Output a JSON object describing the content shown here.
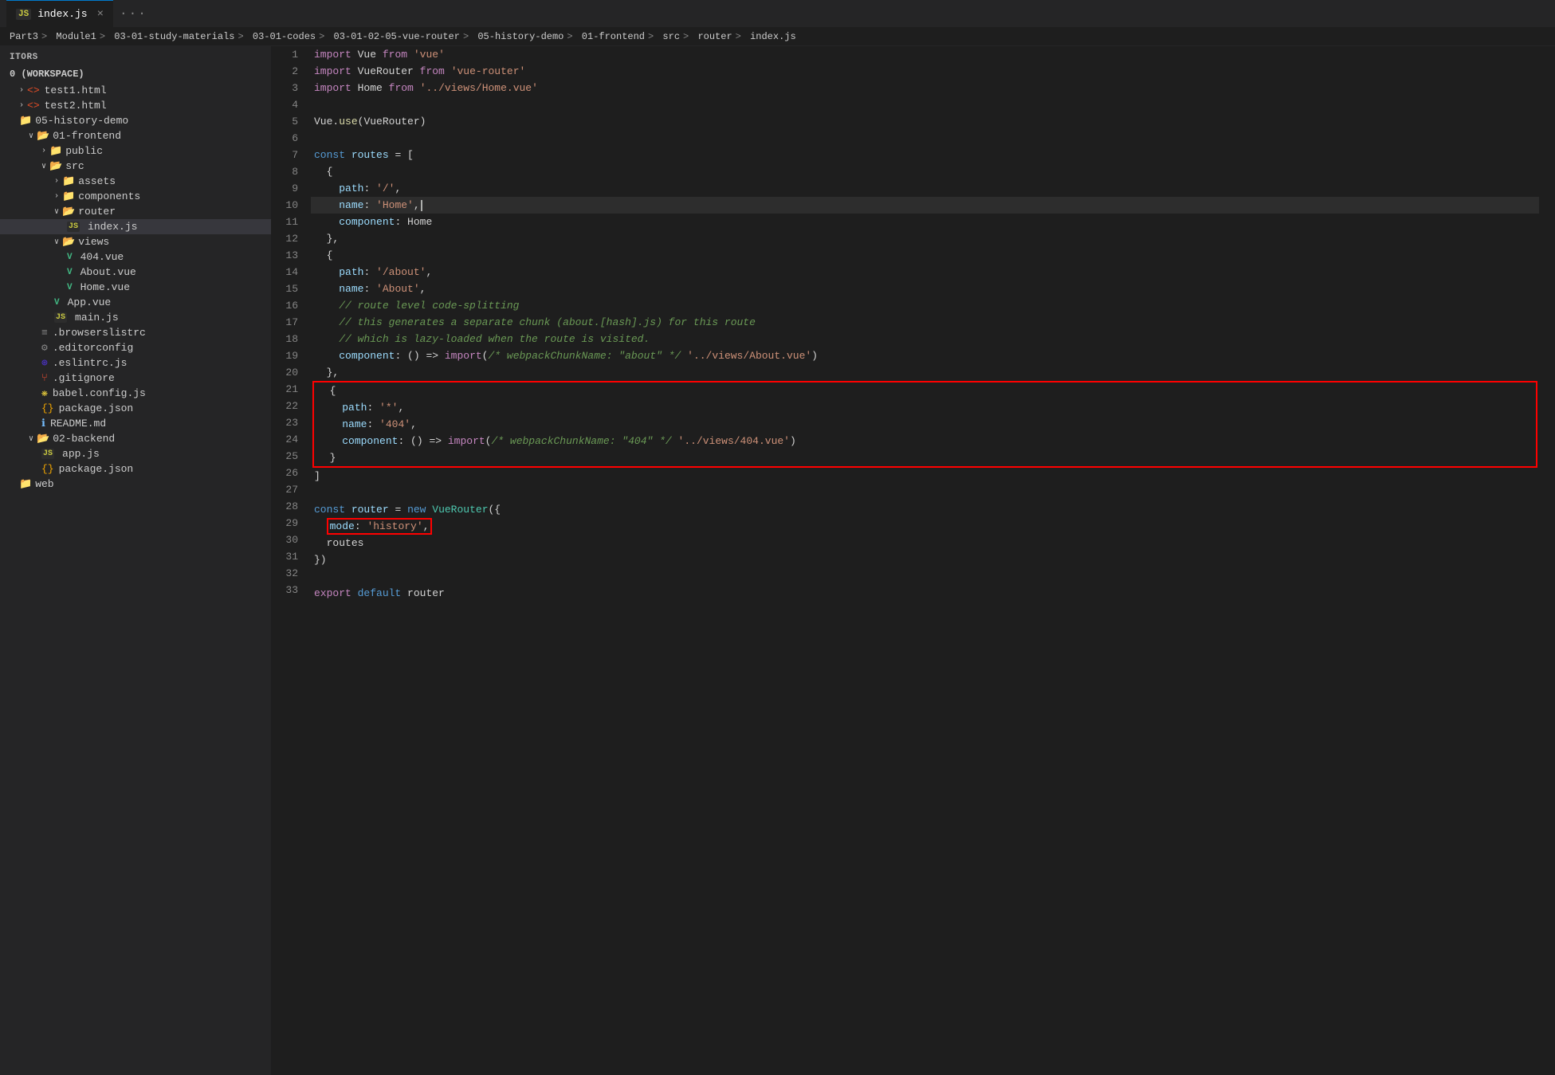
{
  "tab": {
    "icon": "JS",
    "label": "index.js",
    "close": "×"
  },
  "breadcrumb": {
    "parts": [
      "Part3",
      "Module1",
      "03-01-study-materials",
      "03-01-codes",
      "03-01-02-05-vue-router",
      "05-history-demo",
      "01-frontend",
      "src",
      "router",
      "index.js"
    ]
  },
  "sidebar": {
    "header": "ITORS",
    "workspace": "0 (WORKSPACE)",
    "items": [
      {
        "id": "test1",
        "label": "test1.html",
        "icon": "html",
        "indent": 1,
        "expanded": false
      },
      {
        "id": "test2",
        "label": "test2.html",
        "icon": "html",
        "indent": 1,
        "expanded": false
      },
      {
        "id": "05-history-demo",
        "label": "05-history-demo",
        "icon": "folder",
        "indent": 1,
        "expanded": true
      },
      {
        "id": "01-frontend",
        "label": "01-frontend",
        "icon": "folder",
        "indent": 2,
        "expanded": true
      },
      {
        "id": "public",
        "label": "public",
        "icon": "folder",
        "indent": 3,
        "expanded": false
      },
      {
        "id": "src",
        "label": "src",
        "icon": "folder",
        "indent": 3,
        "expanded": true
      },
      {
        "id": "assets",
        "label": "assets",
        "icon": "folder",
        "indent": 4,
        "expanded": false
      },
      {
        "id": "components",
        "label": "components",
        "icon": "folder",
        "indent": 4,
        "expanded": false
      },
      {
        "id": "router",
        "label": "router",
        "icon": "folder",
        "indent": 4,
        "expanded": true
      },
      {
        "id": "index-js",
        "label": "index.js",
        "icon": "js",
        "indent": 5,
        "expanded": false,
        "active": true
      },
      {
        "id": "views",
        "label": "views",
        "icon": "folder",
        "indent": 4,
        "expanded": true
      },
      {
        "id": "404-vue",
        "label": "404.vue",
        "icon": "vue",
        "indent": 5
      },
      {
        "id": "about-vue",
        "label": "About.vue",
        "icon": "vue",
        "indent": 5
      },
      {
        "id": "home-vue",
        "label": "Home.vue",
        "icon": "vue",
        "indent": 5
      },
      {
        "id": "app-vue",
        "label": "App.vue",
        "icon": "vue",
        "indent": 4
      },
      {
        "id": "main-js",
        "label": "main.js",
        "icon": "js",
        "indent": 4
      },
      {
        "id": "browserslistrc",
        "label": ".browserslistrc",
        "icon": "rc",
        "indent": 3
      },
      {
        "id": "editorconfig",
        "label": ".editorconfig",
        "icon": "gear",
        "indent": 3
      },
      {
        "id": "eslintrc",
        "label": ".eslintrc.js",
        "icon": "eslint",
        "indent": 3
      },
      {
        "id": "gitignore",
        "label": ".gitignore",
        "icon": "git",
        "indent": 3
      },
      {
        "id": "babel-config",
        "label": "babel.config.js",
        "icon": "babel",
        "indent": 3
      },
      {
        "id": "package-json",
        "label": "package.json",
        "icon": "json",
        "indent": 3
      },
      {
        "id": "readme",
        "label": "README.md",
        "icon": "info",
        "indent": 3
      },
      {
        "id": "02-backend",
        "label": "02-backend",
        "icon": "folder",
        "indent": 2,
        "expanded": true
      },
      {
        "id": "app-js",
        "label": "app.js",
        "icon": "js",
        "indent": 3
      },
      {
        "id": "package-json-2",
        "label": "package.json",
        "icon": "json",
        "indent": 3
      },
      {
        "id": "web",
        "label": "web",
        "icon": "folder",
        "indent": 1
      }
    ]
  },
  "code": {
    "lines": [
      {
        "num": 1,
        "content": "import Vue from 'vue'"
      },
      {
        "num": 2,
        "content": "import VueRouter from 'vue-router'"
      },
      {
        "num": 3,
        "content": "import Home from '../views/Home.vue'"
      },
      {
        "num": 4,
        "content": ""
      },
      {
        "num": 5,
        "content": "Vue.use(VueRouter)"
      },
      {
        "num": 6,
        "content": ""
      },
      {
        "num": 7,
        "content": "const routes = ["
      },
      {
        "num": 8,
        "content": "  {"
      },
      {
        "num": 9,
        "content": "    path: '/',"
      },
      {
        "num": 10,
        "content": "    name: 'Home',",
        "highlighted": true
      },
      {
        "num": 11,
        "content": "    component: Home"
      },
      {
        "num": 12,
        "content": "  },"
      },
      {
        "num": 13,
        "content": "  {"
      },
      {
        "num": 14,
        "content": "    path: '/about',"
      },
      {
        "num": 15,
        "content": "    name: 'About',"
      },
      {
        "num": 16,
        "content": "    // route level code-splitting"
      },
      {
        "num": 17,
        "content": "    // this generates a separate chunk (about.[hash].js) for this route"
      },
      {
        "num": 18,
        "content": "    // which is lazy-loaded when the route is visited."
      },
      {
        "num": 19,
        "content": "    component: () => import(/* webpackChunkName: \"about\" */ '../views/About.vue')"
      },
      {
        "num": 20,
        "content": "  },"
      },
      {
        "num": 21,
        "content": "  {",
        "redbox_start": true
      },
      {
        "num": 22,
        "content": "    path: '*',"
      },
      {
        "num": 23,
        "content": "    name: '404',"
      },
      {
        "num": 24,
        "content": "    component: () => import(/* webpackChunkName: \"404\" */ '../views/404.vue')"
      },
      {
        "num": 25,
        "content": "  }",
        "redbox_end": true
      },
      {
        "num": 26,
        "content": "]"
      },
      {
        "num": 27,
        "content": ""
      },
      {
        "num": 28,
        "content": "const router = new VueRouter({"
      },
      {
        "num": 29,
        "content": "  mode: 'history',",
        "inline_redbox": true
      },
      {
        "num": 30,
        "content": "  routes"
      },
      {
        "num": 31,
        "content": "})"
      },
      {
        "num": 32,
        "content": ""
      },
      {
        "num": 33,
        "content": "export default router"
      }
    ]
  },
  "colors": {
    "accent": "#007acc",
    "red_box": "#ff0000",
    "active_line_bg": "#2d2d2d"
  }
}
